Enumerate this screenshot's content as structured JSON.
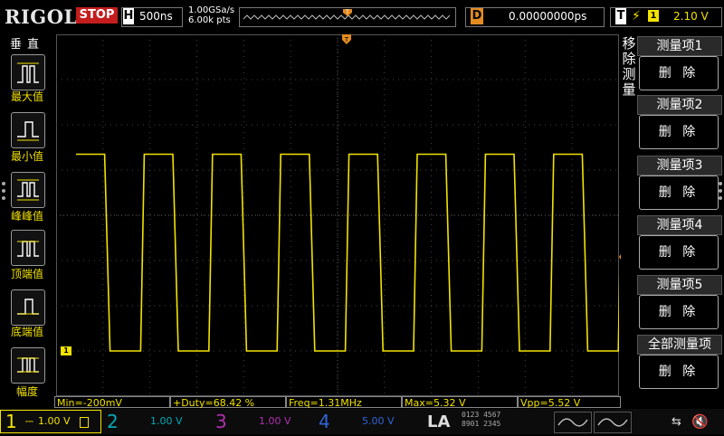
{
  "top": {
    "brand": "RIGOL",
    "run_state": "STOP",
    "horizontal_label": "H",
    "timebase": "500ns",
    "sample_rate": "1.00GSa/s",
    "memory_points": "6.00k pts",
    "delay_label": "D",
    "delay_value": "0.00000000ps",
    "trigger_label": "T",
    "trigger_source": "1",
    "trigger_level": "2.10 V"
  },
  "left_menu": {
    "title": "垂直",
    "items": [
      {
        "label": "最大值",
        "icon": "pulse-max-icon"
      },
      {
        "label": "最小值",
        "icon": "pulse-min-icon"
      },
      {
        "label": "峰峰值",
        "icon": "pulse-peak-peak-icon"
      },
      {
        "label": "顶端值",
        "icon": "pulse-top-icon"
      },
      {
        "label": "底端值",
        "icon": "pulse-base-icon"
      },
      {
        "label": "幅度",
        "icon": "pulse-amplitude-icon"
      }
    ]
  },
  "right_menu": {
    "title_vertical": [
      "移",
      "除",
      "测",
      "量"
    ],
    "buttons": [
      {
        "title": "测量项1",
        "action": "删 除"
      },
      {
        "title": "测量项2",
        "action": "删 除"
      },
      {
        "title": "测量项3",
        "action": "删 除"
      },
      {
        "title": "测量项4",
        "action": "删 除"
      },
      {
        "title": "测量项5",
        "action": "删 除"
      },
      {
        "title": "全部测量项",
        "action": "删 除"
      }
    ]
  },
  "measurements": [
    {
      "text": "Min=-200mV"
    },
    {
      "text": "+Duty=68.42 %"
    },
    {
      "text": "Freq=1.31MHz"
    },
    {
      "text": "Max=5.32 V"
    },
    {
      "text": "Vpp=5.52 V"
    }
  ],
  "channels": [
    {
      "num": "1",
      "scale": "1.00 V",
      "color": "#f2e200",
      "active": true
    },
    {
      "num": "2",
      "scale": "1.00 V",
      "color": "#00d8e8",
      "active": false
    },
    {
      "num": "3",
      "scale": "1.00 V",
      "color": "#e040e0",
      "active": false
    },
    {
      "num": "4",
      "scale": "5.00 V",
      "color": "#3b7cff",
      "active": false
    }
  ],
  "la_label": "LA",
  "la_digits": [
    "0123 4567",
    "8901 2345"
  ],
  "screen": {
    "channel_marker": "1",
    "trace_color": "#f2e200",
    "waveform": {
      "high_v": 5.32,
      "low_v": -0.2,
      "periods_visible": 8
    }
  },
  "colors": {
    "trigger_marker": "#e38b21",
    "stop": "#c41d1d"
  }
}
